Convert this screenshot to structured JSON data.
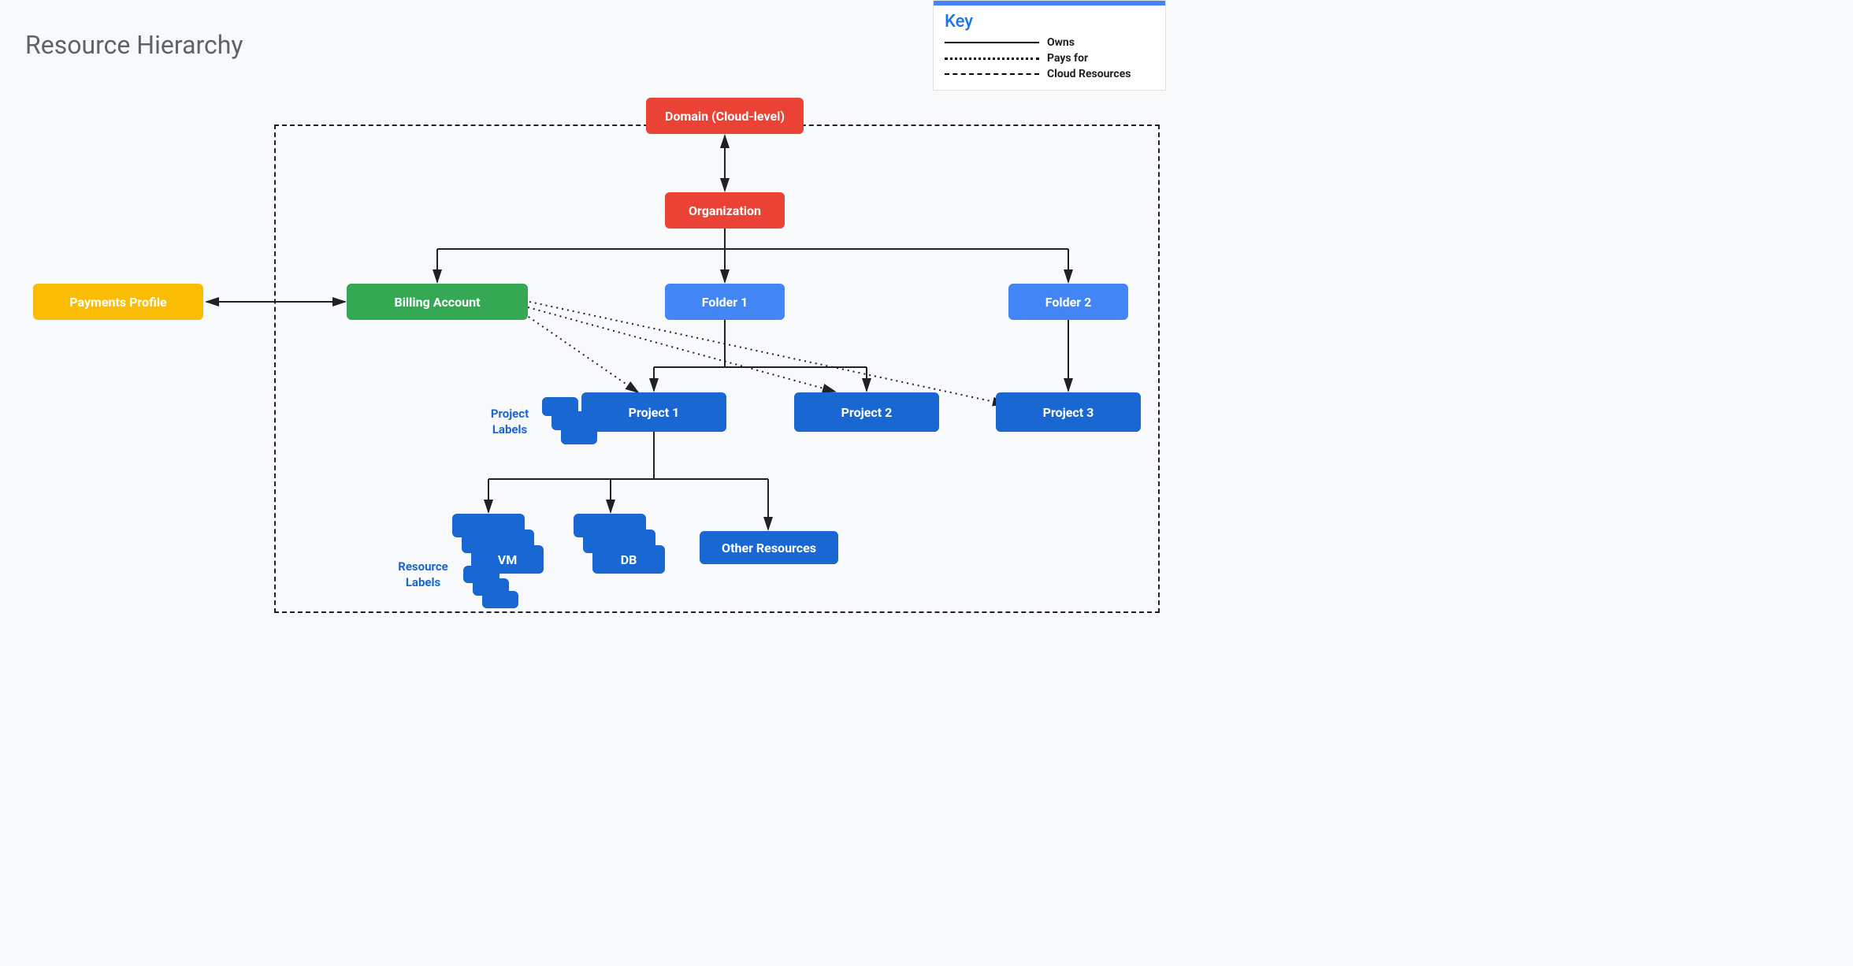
{
  "title": "Resource Hierarchy",
  "key": {
    "title": "Key",
    "items": [
      {
        "label": "Owns",
        "style": "solid"
      },
      {
        "label": "Pays for",
        "style": "dotted"
      },
      {
        "label": "Cloud Resources",
        "style": "dashed"
      }
    ]
  },
  "nodes": {
    "domain": "Domain (Cloud-level)",
    "organization": "Organization",
    "payments_profile": "Payments Profile",
    "billing_account": "Billing Account",
    "folder1": "Folder 1",
    "folder2": "Folder 2",
    "project1": "Project 1",
    "project2": "Project 2",
    "project3": "Project 3",
    "vm": "VM",
    "db": "DB",
    "other_resources": "Other Resources"
  },
  "labels": {
    "project_labels": "Project Labels",
    "resource_labels": "Resource Labels"
  },
  "edges": {
    "owns": [
      [
        "domain",
        "organization"
      ],
      [
        "organization",
        "billing_account"
      ],
      [
        "organization",
        "folder1"
      ],
      [
        "organization",
        "folder2"
      ],
      [
        "folder1",
        "project1"
      ],
      [
        "folder1",
        "project2"
      ],
      [
        "folder2",
        "project3"
      ],
      [
        "project1",
        "vm"
      ],
      [
        "project1",
        "db"
      ],
      [
        "project1",
        "other_resources"
      ],
      [
        "payments_profile",
        "billing_account"
      ]
    ],
    "pays_for": [
      [
        "billing_account",
        "project1"
      ],
      [
        "billing_account",
        "project2"
      ],
      [
        "billing_account",
        "project3"
      ]
    ]
  }
}
